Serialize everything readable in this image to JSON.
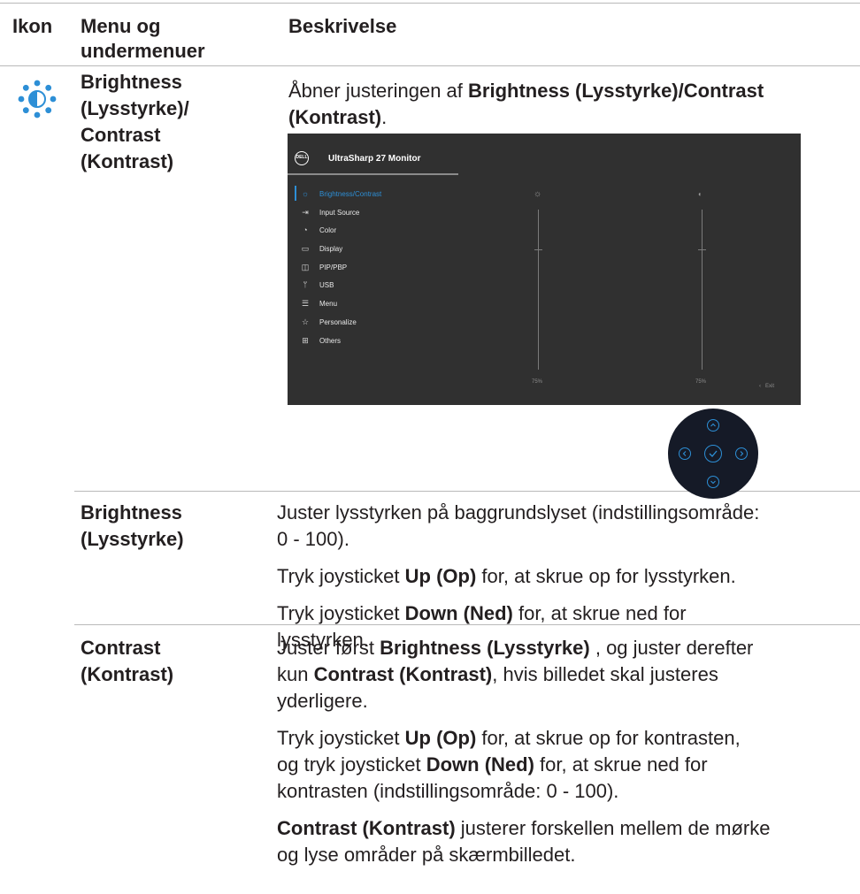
{
  "header": {
    "col_icon": "Ikon",
    "col_menu_line1": "Menu og",
    "col_menu_line2": "undermenuer",
    "col_desc": "Beskrivelse"
  },
  "row_main": {
    "icon": "brightness-contrast-icon",
    "menu_lines": [
      "Brightness",
      "(Lysstyrke)/",
      "Contrast",
      "(Kontrast)"
    ],
    "desc_pre": "Åbner justeringen af ",
    "desc_bold1": "Brightness (Lysstyrke)/Contrast",
    "desc_bold2": "(Kontrast)",
    "desc_post": "."
  },
  "osd": {
    "logo": "DELL",
    "title": "UltraSharp 27 Monitor",
    "menu_items": [
      {
        "label": "Brightness/Contrast",
        "icon": "sun-icon",
        "active": true
      },
      {
        "label": "Input Source",
        "icon": "input-icon",
        "active": false
      },
      {
        "label": "Color",
        "icon": "palette-icon",
        "active": false
      },
      {
        "label": "Display",
        "icon": "monitor-icon",
        "active": false
      },
      {
        "label": "PIP/PBP",
        "icon": "pip-icon",
        "active": false
      },
      {
        "label": "USB",
        "icon": "usb-icon",
        "active": false
      },
      {
        "label": "Menu",
        "icon": "menu-icon",
        "active": false
      },
      {
        "label": "Personalize",
        "icon": "star-icon",
        "active": false
      },
      {
        "label": "Others",
        "icon": "others-icon",
        "active": false
      }
    ],
    "brightness_value": "75%",
    "contrast_value": "75%",
    "brightness_level": 75,
    "contrast_level": 75,
    "exit_label": "Exit",
    "accent_color": "#2d8fd6"
  },
  "row_brightness": {
    "menu_lines": [
      "Brightness",
      "(Lysstyrke)"
    ],
    "p1_line1": "Juster lysstyrken på baggrundslyset (indstillingsområde:",
    "p1_line2": "0 - 100).",
    "p2_pre": "Tryk joysticket ",
    "p2_bold": "Up (Op)",
    "p2_post": " for, at skrue op for lysstyrken.",
    "p3_pre": "Tryk joysticket ",
    "p3_bold": "Down (Ned)",
    "p3_post1": " for, at skrue ned for",
    "p3_line2": "lysstyrken."
  },
  "row_contrast": {
    "menu_lines": [
      "Contrast",
      "(Kontrast)"
    ],
    "p1_l1_pre": "Juster først ",
    "p1_l1_bold": "Brightness (Lysstyrke)",
    "p1_l1_post": " , og juster derefter",
    "p1_l2_pre": "kun ",
    "p1_l2_bold": "Contrast (Kontrast)",
    "p1_l2_post": ", hvis billedet skal justeres",
    "p1_l3": "yderligere.",
    "p2_l1_pre": "Tryk joysticket ",
    "p2_l1_bold": "Up (Op)",
    "p2_l1_post": " for, at skrue op for kontrasten,",
    "p2_l2_pre": "og tryk joysticket ",
    "p2_l2_bold": "Down (Ned)",
    "p2_l2_post": " for, at skrue ned for",
    "p2_l3": "kontrasten (indstillingsområde: 0 - 100).",
    "p3_l1_bold": "Contrast (Kontrast)",
    "p3_l1_post": " justerer forskellen mellem de mørke",
    "p3_l2": "og lyse områder på skærmbilledet."
  },
  "colors": {
    "accent": "#2d8fd6",
    "text": "#231f20",
    "osd_bg": "#303030"
  }
}
